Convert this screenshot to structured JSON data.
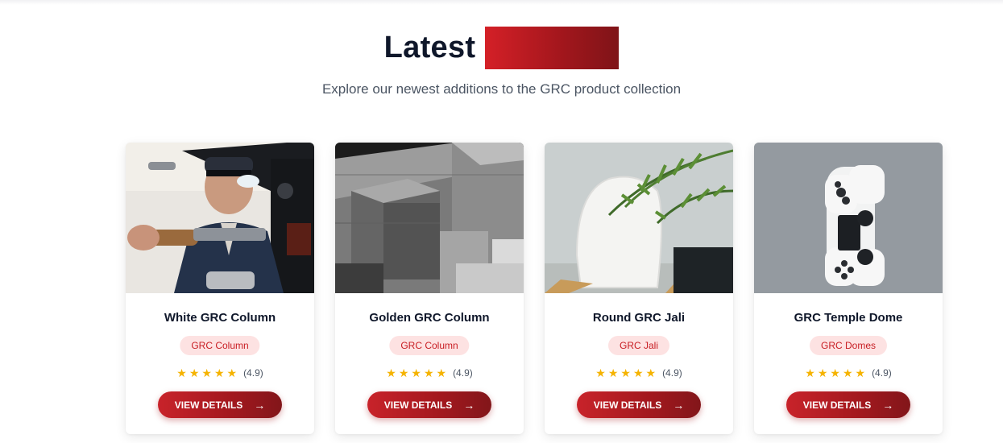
{
  "section": {
    "title": "Latest",
    "subtitle": "Explore our newest additions to the GRC product collection",
    "highlight_color": "#b01a20"
  },
  "products": [
    {
      "title": "White GRC Column",
      "category": "GRC Column",
      "rating": "(4.9)",
      "stars": 5,
      "button_label": "VIEW DETAILS",
      "image_icon": "craftsman-photo"
    },
    {
      "title": "Golden GRC Column",
      "category": "GRC Column",
      "rating": "(4.9)",
      "stars": 5,
      "button_label": "VIEW DETAILS",
      "image_icon": "concrete-blocks-photo"
    },
    {
      "title": "Round GRC Jali",
      "category": "GRC Jali",
      "rating": "(4.9)",
      "stars": 5,
      "button_label": "VIEW DETAILS",
      "image_icon": "chair-plant-photo"
    },
    {
      "title": "GRC Temple Dome",
      "category": "GRC Domes",
      "rating": "(4.9)",
      "stars": 5,
      "button_label": "VIEW DETAILS",
      "image_icon": "game-controller-photo"
    }
  ],
  "icons": {
    "star": "star-icon",
    "arrow": "arrow-right-icon"
  },
  "colors": {
    "accent": "#c8232a",
    "tag_bg": "#fde2e2",
    "star": "#f5b301"
  }
}
